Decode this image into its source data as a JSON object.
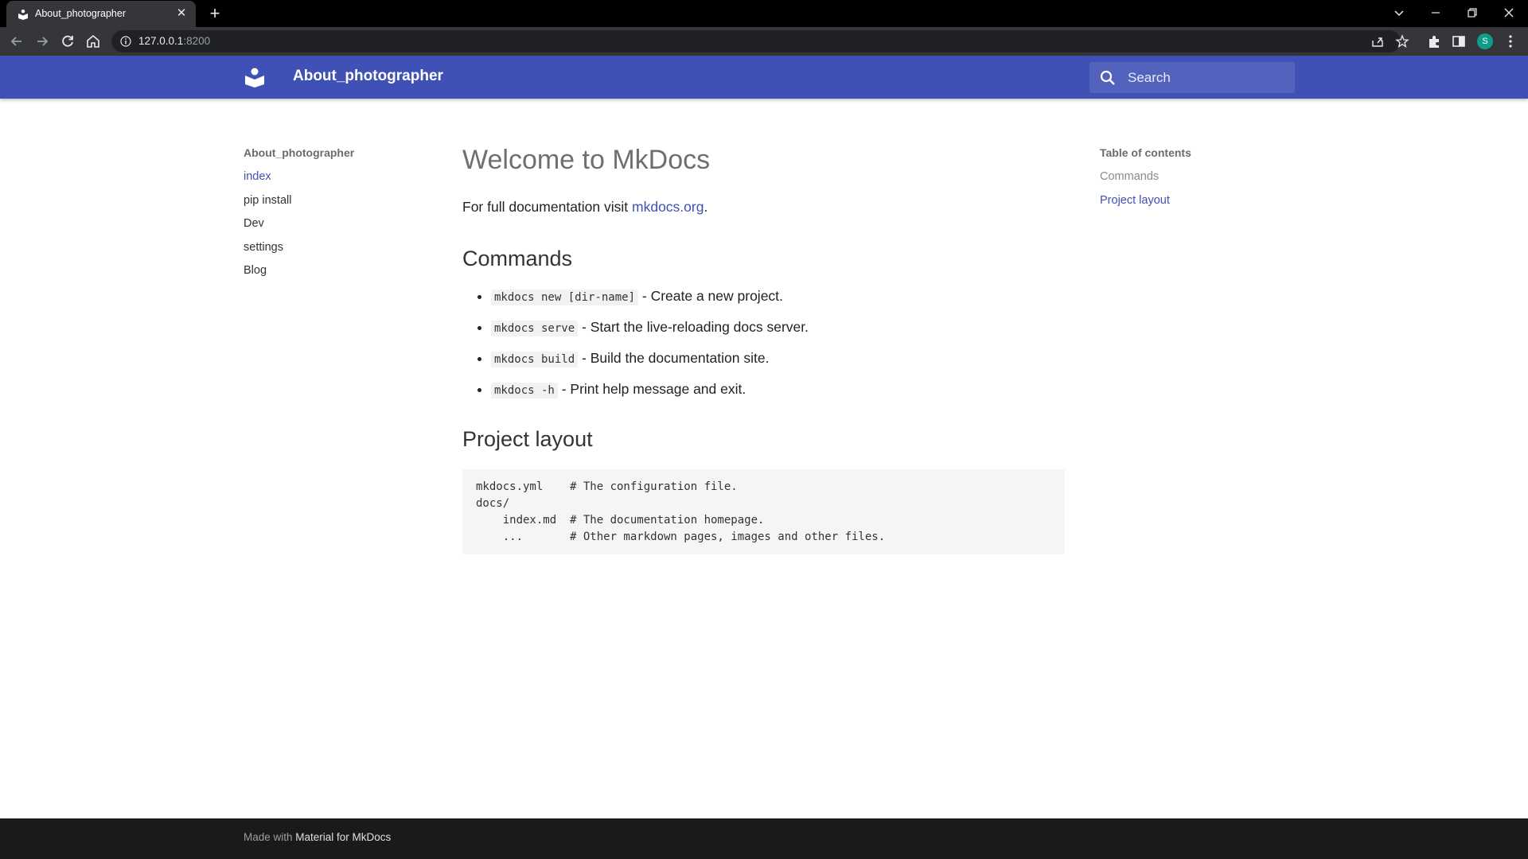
{
  "browser": {
    "tab_title": "About_photographer",
    "url_host": "127.0.0.1",
    "url_port": ":8200",
    "profile_initial": "S"
  },
  "header": {
    "site_title": "About_photographer",
    "search_placeholder": "Search"
  },
  "nav": {
    "title": "About_photographer",
    "items": [
      {
        "label": "index",
        "active": true
      },
      {
        "label": "pip install",
        "active": false
      },
      {
        "label": "Dev",
        "active": false
      },
      {
        "label": "settings",
        "active": false
      },
      {
        "label": "Blog",
        "active": false
      }
    ]
  },
  "toc": {
    "title": "Table of contents",
    "items": [
      {
        "label": "Commands"
      },
      {
        "label": "Project layout"
      }
    ]
  },
  "content": {
    "title": "Welcome to MkDocs",
    "intro_text": "For full documentation visit ",
    "intro_link": "mkdocs.org",
    "intro_end": ".",
    "commands_heading": "Commands",
    "commands": [
      {
        "code": "mkdocs new [dir-name]",
        "desc": " - Create a new project."
      },
      {
        "code": "mkdocs serve",
        "desc": " - Start the live-reloading docs server."
      },
      {
        "code": "mkdocs build",
        "desc": " - Build the documentation site."
      },
      {
        "code": "mkdocs -h",
        "desc": " - Print help message and exit."
      }
    ],
    "layout_heading": "Project layout",
    "layout_code": "mkdocs.yml    # The configuration file.\ndocs/\n    index.md  # The documentation homepage.\n    ...       # Other markdown pages, images and other files."
  },
  "footer": {
    "prefix": "Made with ",
    "link": "Material for MkDocs"
  },
  "colors": {
    "primary": "#3f51b5",
    "footer_bg": "#1a1a1a"
  }
}
